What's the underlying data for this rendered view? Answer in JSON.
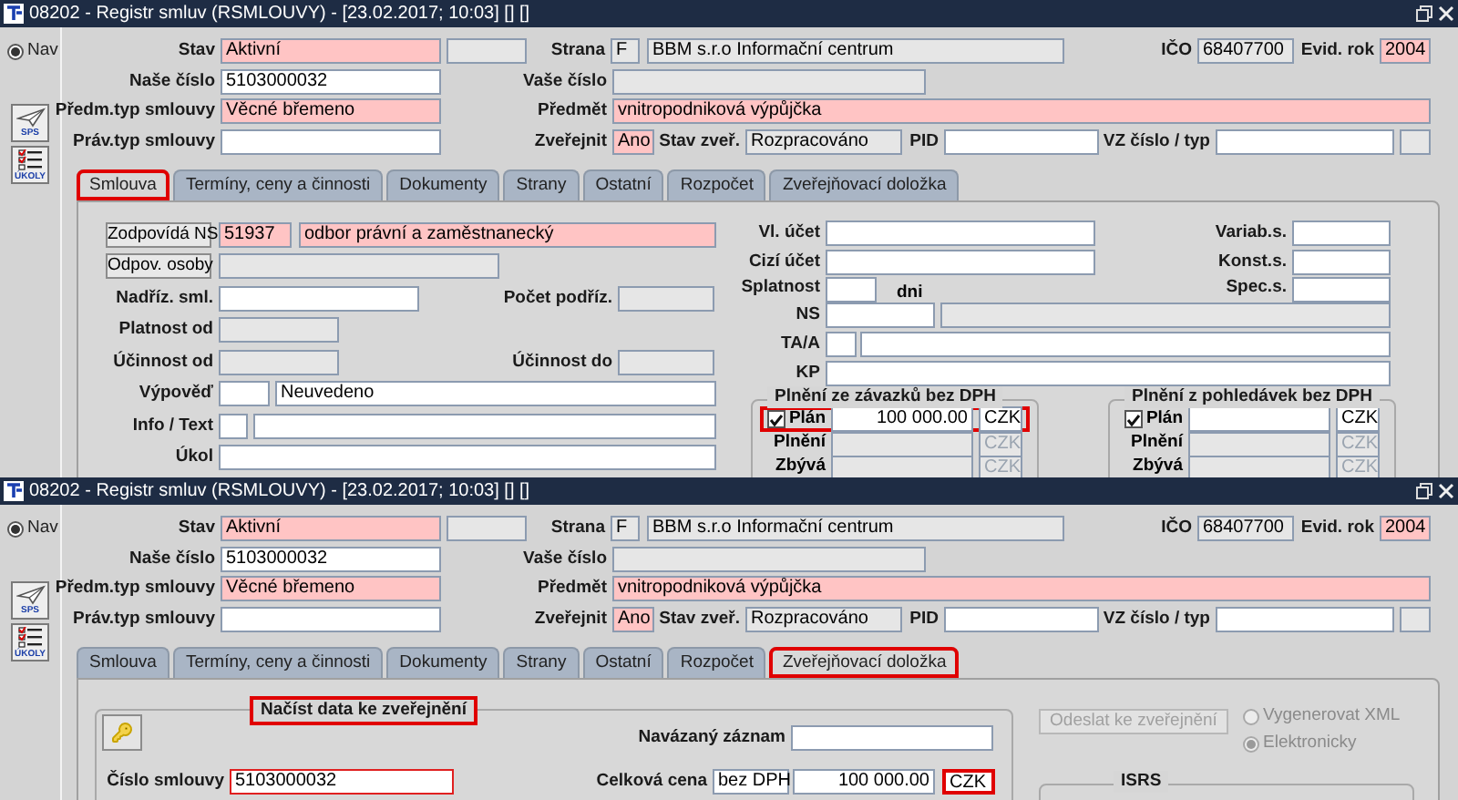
{
  "windows": [
    {
      "title": "08202 - Registr smluv (RSMLOUVY) - [23.02.2017; 10:03] [] []",
      "nav": {
        "label": "Nav",
        "selected": true
      },
      "side_buttons": [
        {
          "label": "SPS",
          "kind": "plane"
        },
        {
          "label": "ÚKOLY",
          "kind": "checklist"
        }
      ],
      "header": {
        "stav": {
          "label": "Stav",
          "value": "Aktivní"
        },
        "strana": {
          "label": "Strana",
          "code": "F",
          "value": "BBM s.r.o Informační centrum"
        },
        "ico": {
          "label": "IČO",
          "value": "68407700"
        },
        "evid_rok": {
          "label": "Evid. rok",
          "value": "2004"
        },
        "nase_cislo": {
          "label": "Naše číslo",
          "value": "5103000032"
        },
        "vase_cislo": {
          "label": "Vaše číslo"
        },
        "predm_typ": {
          "label": "Předm.typ smlouvy",
          "value": "Věcné břemeno"
        },
        "predmet": {
          "label": "Předmět",
          "value": "vnitropodniková výpůjčka"
        },
        "prav_typ": {
          "label": "Práv.typ smlouvy"
        },
        "zverejnit": {
          "label": "Zveřejnit",
          "value": "Ano"
        },
        "stav_zver": {
          "label": "Stav zveř.",
          "value": "Rozpracováno"
        },
        "pid": {
          "label": "PID"
        },
        "vz": {
          "label": "VZ číslo / typ"
        }
      },
      "tabs": [
        {
          "label": "Smlouva",
          "selected": true,
          "highlighted": true
        },
        {
          "label": "Termíny, ceny a činnosti",
          "selected": false,
          "highlighted": false
        },
        {
          "label": "Dokumenty",
          "selected": false,
          "highlighted": false
        },
        {
          "label": "Strany",
          "selected": false,
          "highlighted": false
        },
        {
          "label": "Ostatní",
          "selected": false,
          "highlighted": false
        },
        {
          "label": "Rozpočet",
          "selected": false,
          "highlighted": false
        },
        {
          "label": "Zveřejňovací doložka",
          "selected": false,
          "highlighted": false
        }
      ],
      "body": {
        "kind": "smlouva",
        "zodpovida": {
          "button": "Zodpovídá NS",
          "code": "51937",
          "value": "odbor právní a zaměstnanecký"
        },
        "odpov_osoby": {
          "button": "Odpov. osoby"
        },
        "nadriz": {
          "label": "Nadříz. sml."
        },
        "pocet_podriz": {
          "label": "Počet podříz."
        },
        "platnost_od": {
          "label": "Platnost od"
        },
        "ucinnost_od": {
          "label": "Účinnost od"
        },
        "ucinnost_do": {
          "label": "Účinnost do"
        },
        "vypoved": {
          "label": "Výpověď",
          "value": "Neuvedeno"
        },
        "info_text": {
          "label": "Info / Text"
        },
        "ukol": {
          "label": "Úkol"
        },
        "vl_ucet": {
          "label": "Vl. účet"
        },
        "variab": {
          "label": "Variab.s."
        },
        "cizi_ucet": {
          "label": "Cizí účet"
        },
        "konst": {
          "label": "Konst.s."
        },
        "splatnost": {
          "label": "Splatnost",
          "unit": "dni"
        },
        "spec": {
          "label": "Spec.s."
        },
        "ns": {
          "label": "NS"
        },
        "ta_a": {
          "label": "TA/A"
        },
        "kp": {
          "label": "KP"
        },
        "groups": [
          {
            "title": "Plnění ze závazků bez DPH",
            "rows": [
              {
                "kind": "plan",
                "label": "Plán",
                "checked": true,
                "value": "100 000.00",
                "currency": "CZK",
                "highlighted": true
              },
              {
                "kind": "sum",
                "label": "Plnění",
                "currency": "CZK"
              },
              {
                "kind": "sum",
                "label": "Zbývá",
                "currency": "CZK"
              }
            ]
          },
          {
            "title": "Plnění z pohledávek bez DPH",
            "rows": [
              {
                "kind": "plan",
                "label": "Plán",
                "checked": true,
                "currency": "CZK",
                "highlighted": false
              },
              {
                "kind": "sum",
                "label": "Plnění",
                "currency": "CZK"
              },
              {
                "kind": "sum",
                "label": "Zbývá",
                "currency": "CZK"
              }
            ]
          }
        ]
      }
    },
    {
      "title": "08202 - Registr smluv (RSMLOUVY) - [23.02.2017; 10:03] [] []",
      "nav": {
        "label": "Nav",
        "selected": true
      },
      "side_buttons": [
        {
          "label": "SPS",
          "kind": "plane"
        },
        {
          "label": "ÚKOLY",
          "kind": "checklist"
        }
      ],
      "header": {
        "stav": {
          "label": "Stav",
          "value": "Aktivní"
        },
        "strana": {
          "label": "Strana",
          "code": "F",
          "value": "BBM s.r.o Informační centrum"
        },
        "ico": {
          "label": "IČO",
          "value": "68407700"
        },
        "evid_rok": {
          "label": "Evid. rok",
          "value": "2004"
        },
        "nase_cislo": {
          "label": "Naše číslo",
          "value": "5103000032"
        },
        "vase_cislo": {
          "label": "Vaše číslo"
        },
        "predm_typ": {
          "label": "Předm.typ smlouvy",
          "value": "Věcné břemeno"
        },
        "predmet": {
          "label": "Předmět",
          "value": "vnitropodniková výpůjčka"
        },
        "prav_typ": {
          "label": "Práv.typ smlouvy"
        },
        "zverejnit": {
          "label": "Zveřejnit",
          "value": "Ano"
        },
        "stav_zver": {
          "label": "Stav zveř.",
          "value": "Rozpracováno"
        },
        "pid": {
          "label": "PID"
        },
        "vz": {
          "label": "VZ číslo / typ"
        }
      },
      "tabs": [
        {
          "label": "Smlouva",
          "selected": false,
          "highlighted": false
        },
        {
          "label": "Termíny, ceny a činnosti",
          "selected": false,
          "highlighted": false
        },
        {
          "label": "Dokumenty",
          "selected": false,
          "highlighted": false
        },
        {
          "label": "Strany",
          "selected": false,
          "highlighted": false
        },
        {
          "label": "Ostatní",
          "selected": false,
          "highlighted": false
        },
        {
          "label": "Rozpočet",
          "selected": false,
          "highlighted": false
        },
        {
          "label": "Zveřejňovací doložka",
          "selected": true,
          "highlighted": true
        }
      ],
      "body": {
        "kind": "zverejneni",
        "group": {
          "title": "Načíst data ke zveřejnění",
          "highlighted": true
        },
        "navazany": {
          "label": "Navázaný záznam"
        },
        "cislo_smlouvy": {
          "label": "Číslo smlouvy",
          "value": "5103000032",
          "invalid": true
        },
        "celkova_cena": {
          "label": "Celková cena",
          "tax": "bez DPH",
          "value": "100 000.00",
          "currency": "CZK",
          "currency_highlighted": true
        },
        "send_button": {
          "label": "Odeslat ke zveřejnění",
          "disabled": true
        },
        "options": [
          {
            "label": "Vygenerovat XML",
            "selected": false,
            "disabled": true
          },
          {
            "label": "Elektronicky",
            "selected": true,
            "disabled": true
          }
        ],
        "isrs": {
          "title": "ISRS"
        }
      }
    }
  ]
}
